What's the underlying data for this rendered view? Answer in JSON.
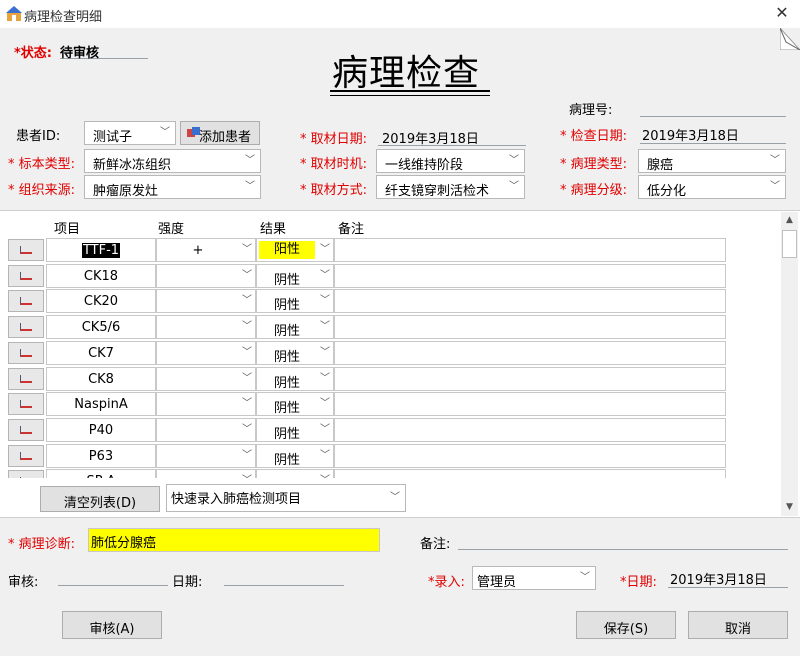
{
  "window": {
    "title": "病理检查明细",
    "close_glyph": "✕"
  },
  "header": {
    "status_label": "*状态:",
    "status_value": "待审核",
    "big_title": "病理检查"
  },
  "form": {
    "pathology_no_label": "病理号:",
    "patient_id_label": "患者ID:",
    "patient_id_value": "测试子",
    "add_patient_label": "添加患者",
    "sampling_date_label": "* 取材日期:",
    "sampling_date_value": "2019年3月18日",
    "check_date_label": "* 检查日期:",
    "check_date_value": "2019年3月18日",
    "specimen_type_label": "* 标本类型:",
    "specimen_type_value": "新鲜冰冻组织",
    "sampling_timing_label": "* 取材时机:",
    "sampling_timing_value": "一线维持阶段",
    "pathology_type_label": "* 病理类型:",
    "pathology_type_value": "腺癌",
    "tissue_source_label": "* 组织来源:",
    "tissue_source_value": "肿瘤原发灶",
    "sampling_method_label": "* 取材方式:",
    "sampling_method_value": "纤支镜穿刺活检术",
    "pathology_grade_label": "* 病理分级:",
    "pathology_grade_value": "低分化"
  },
  "grid": {
    "columns": [
      "项目",
      "强度",
      "结果",
      "备注"
    ],
    "rows": [
      {
        "item": "TTF-1",
        "intensity": "+",
        "result": "阳性",
        "note": ""
      },
      {
        "item": "CK18",
        "intensity": "",
        "result": "阴性",
        "note": ""
      },
      {
        "item": "CK20",
        "intensity": "",
        "result": "阴性",
        "note": ""
      },
      {
        "item": "CK5/6",
        "intensity": "",
        "result": "阴性",
        "note": ""
      },
      {
        "item": "CK7",
        "intensity": "",
        "result": "阴性",
        "note": ""
      },
      {
        "item": "CK8",
        "intensity": "",
        "result": "阴性",
        "note": ""
      },
      {
        "item": "NaspinA",
        "intensity": "",
        "result": "阴性",
        "note": ""
      },
      {
        "item": "P40",
        "intensity": "",
        "result": "阴性",
        "note": ""
      },
      {
        "item": "P63",
        "intensity": "",
        "result": "阴性",
        "note": ""
      },
      {
        "item": "SP-A",
        "intensity": "",
        "result": "阴性",
        "note": ""
      }
    ],
    "clear_label": "清空列表(D)",
    "quick_entry_value": "快速录入肺癌检测项目"
  },
  "bottom": {
    "diagnosis_label": "* 病理诊断:",
    "diagnosis_value": "肺低分腺癌",
    "note_label": "备注:",
    "review_label": "审核:",
    "date_label": "日期:",
    "entry_label": "*录入:",
    "entry_value": "管理员",
    "entry_date_label": "*日期:",
    "entry_date_value": "2019年3月18日",
    "review_button": "审核(A)",
    "save_button": "保存(S)",
    "cancel_button": "取消"
  },
  "colors": {
    "required": "#e00000",
    "highlight": "#ffff00"
  },
  "icons": [
    "app-icon",
    "close-icon",
    "add-patient-icon",
    "row-edit-icon",
    "chevron-down-icon",
    "scroll-up-icon",
    "scroll-down-icon"
  ]
}
